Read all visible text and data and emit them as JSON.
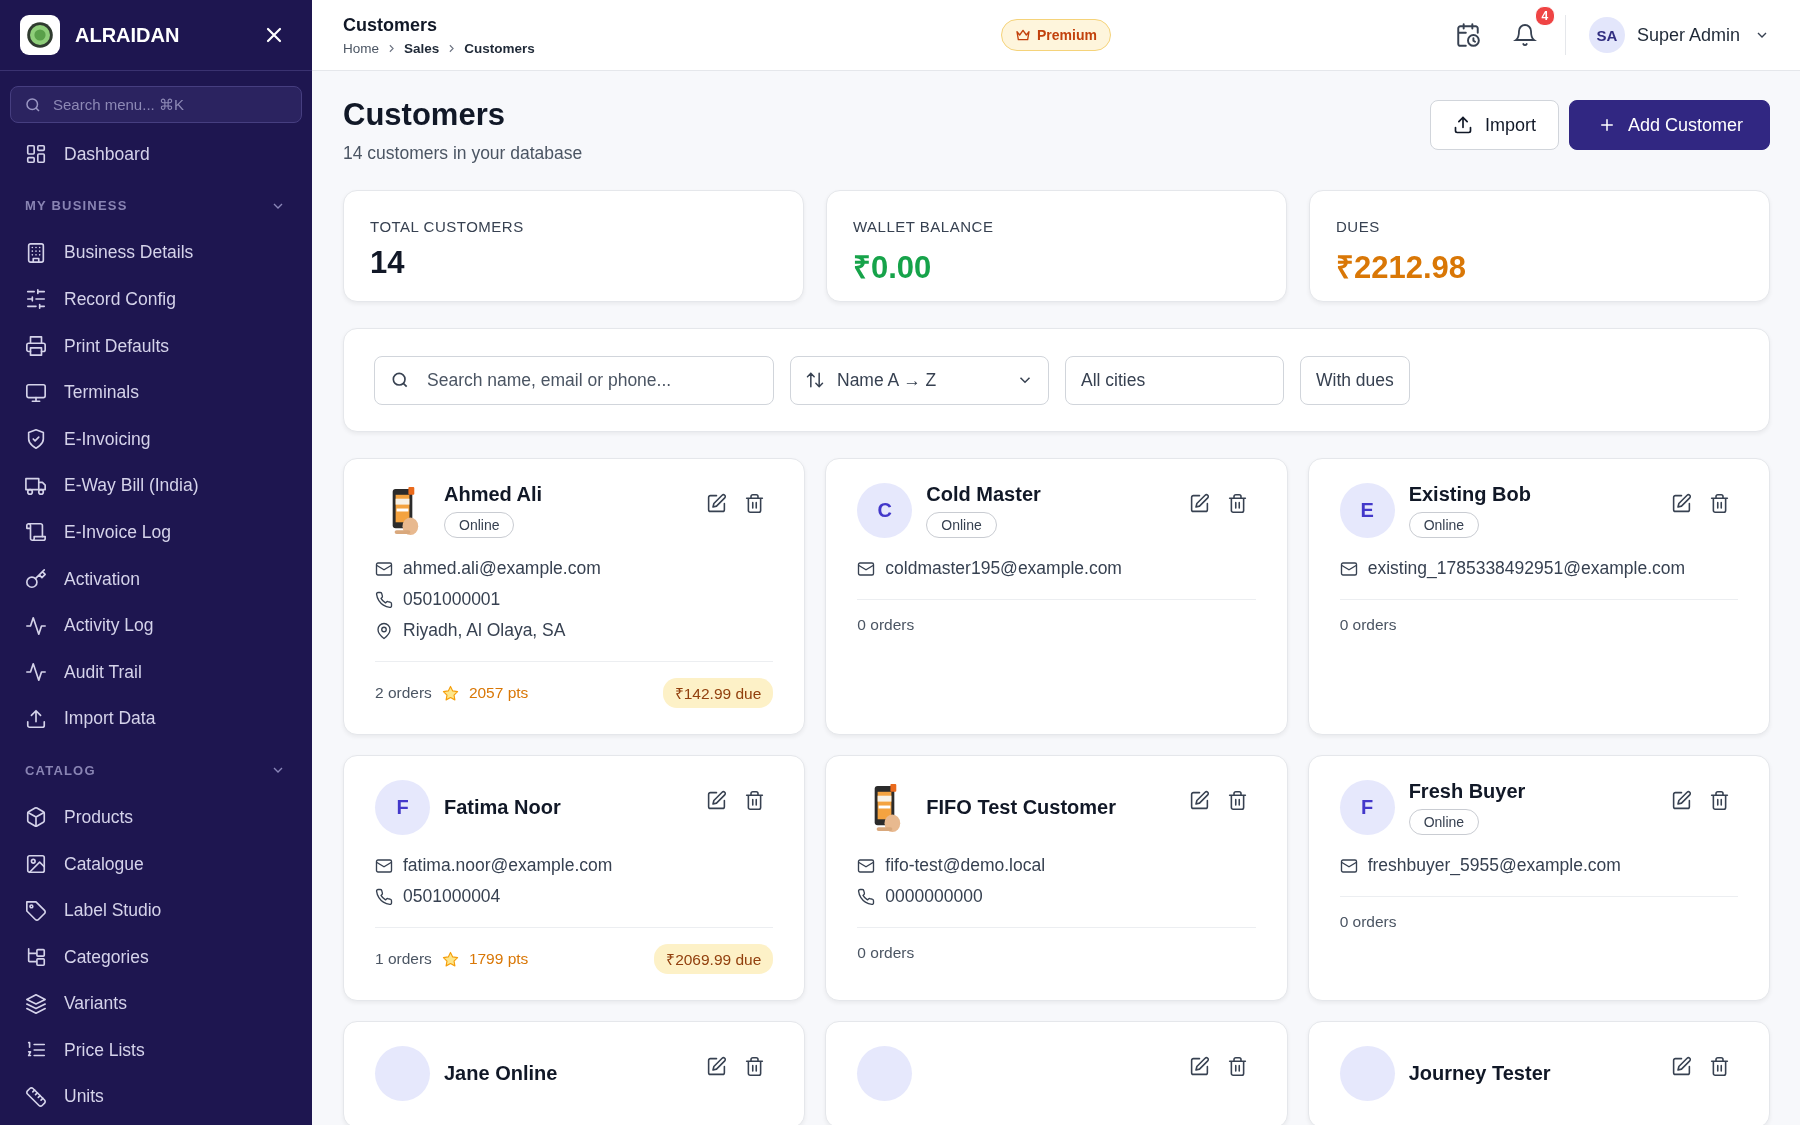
{
  "sidebar": {
    "brand": "ALRAIDAN",
    "search": {
      "placeholder": "Search menu... ⌘K"
    },
    "groups": [
      {
        "items": [
          {
            "label": "Dashboard"
          }
        ]
      },
      {
        "label": "MY BUSINESS",
        "expanded": true,
        "items": [
          {
            "label": "Business Details"
          },
          {
            "label": "Record Config"
          },
          {
            "label": "Print Defaults"
          },
          {
            "label": "Terminals"
          },
          {
            "label": "E-Invoicing"
          },
          {
            "label": "E-Way Bill (India)"
          },
          {
            "label": "E-Invoice Log"
          },
          {
            "label": "Activation"
          },
          {
            "label": "Activity Log"
          },
          {
            "label": "Audit Trail"
          },
          {
            "label": "Import Data"
          }
        ]
      },
      {
        "label": "CATALOG",
        "expanded": true,
        "items": [
          {
            "label": "Products"
          },
          {
            "label": "Catalogue"
          },
          {
            "label": "Label Studio"
          },
          {
            "label": "Categories"
          },
          {
            "label": "Variants"
          },
          {
            "label": "Price Lists"
          },
          {
            "label": "Units"
          }
        ]
      }
    ]
  },
  "header": {
    "title": "Customers",
    "breadcrumb": [
      "Home",
      "Sales",
      "Customers"
    ],
    "badge": "Premium",
    "notifications": "4",
    "user": {
      "initials": "SA",
      "name": "Super Admin"
    }
  },
  "page": {
    "title": "Customers",
    "subtitle": "14 customers in your database",
    "buttons": [
      {
        "label": "Import",
        "kind": "secondary"
      },
      {
        "label": "Add Customer",
        "kind": "primary"
      }
    ]
  },
  "stats": [
    {
      "label": "TOTAL CUSTOMERS",
      "value": "14",
      "color": "#111827"
    },
    {
      "label": "WALLET BALANCE",
      "value": "₹0.00",
      "color": "#16a34a"
    },
    {
      "label": "DUES",
      "value": "₹2212.98",
      "color": "#d97706"
    }
  ],
  "filters": {
    "search": {
      "placeholder": "Search name, email or phone..."
    },
    "sort": "Name A → Z",
    "city": "All cities",
    "dues_toggle": "With dues"
  },
  "customers": [
    {
      "name": "Ahmed Ali",
      "badge": "Online",
      "email": "ahmed.ali@example.com",
      "phone": "0501000001",
      "address": "Riyadh, Al Olaya, SA",
      "orders": "2 orders",
      "points": "2057 pts",
      "due": "₹142.99 due"
    },
    {
      "avatar": {
        "kind": "letter",
        "letter": "C"
      },
      "name": "Cold Master",
      "badge": "Online",
      "email": "coldmaster195@example.com",
      "orders": "0 orders"
    },
    {
      "avatar": {
        "kind": "letter",
        "letter": "E"
      },
      "name": "Existing Bob",
      "badge": "Online",
      "email": "existing_1785338492951@example.com",
      "orders": "0 orders"
    },
    {
      "avatar": {
        "kind": "letter",
        "letter": "F"
      },
      "name": "Fatima Noor",
      "email": "fatima.noor@example.com",
      "phone": "0501000004",
      "orders": "1 orders",
      "points": "1799 pts",
      "due": "₹2069.99 due"
    },
    {
      "name": "FIFO Test Customer",
      "email": "fifo-test@demo.local",
      "phone": "0000000000",
      "orders": "0 orders"
    },
    {
      "avatar": {
        "kind": "letter",
        "letter": "F"
      },
      "name": "Fresh Buyer",
      "badge": "Online",
      "email": "freshbuyer_5955@example.com",
      "orders": "0 orders"
    },
    {
      "avatar": {
        "kind": "letter"
      },
      "name": "Jane Online"
    },
    {
      "avatar": {
        "kind": "letter"
      }
    },
    {
      "avatar": {
        "kind": "letter"
      },
      "name": "Journey Tester"
    }
  ]
}
